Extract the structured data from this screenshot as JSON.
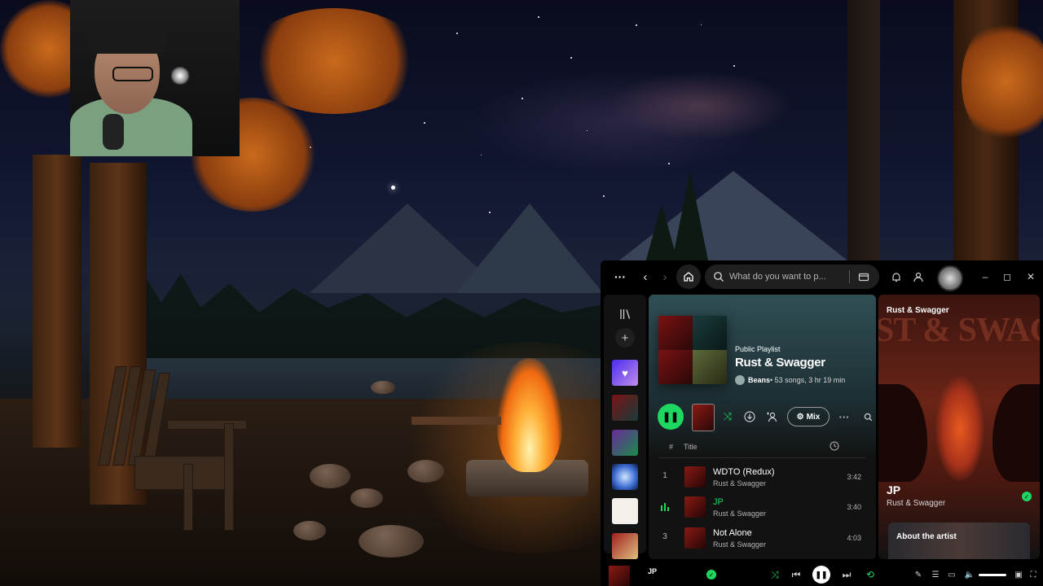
{
  "topbar": {
    "search_placeholder": "What do you want to p..."
  },
  "playlist": {
    "kind": "Public Playlist",
    "name": "Rust & Swagger",
    "owner": "Beans",
    "meta": " • 53 songs, 3 hr 19 min"
  },
  "actions": {
    "mix_label": "Mix"
  },
  "table": {
    "col_num": "#",
    "col_title": "Title"
  },
  "tracks": [
    {
      "num": "1",
      "title": "WDTO (Redux)",
      "artist": "Rust & Swagger",
      "duration": "3:42"
    },
    {
      "num": "",
      "title": "JP",
      "artist": "Rust & Swagger",
      "duration": "3:40"
    },
    {
      "num": "3",
      "title": "Not Alone",
      "artist": "Rust & Swagger",
      "duration": "4:03"
    }
  ],
  "now_playing": {
    "context": "Rust & Swagger",
    "song": "JP",
    "artist": "Rust & Swagger",
    "about_label": "About the artist"
  },
  "player": {
    "song": "JP"
  },
  "colors": {
    "accent": "#1ed760",
    "background": "#000000",
    "panel": "#121212"
  }
}
